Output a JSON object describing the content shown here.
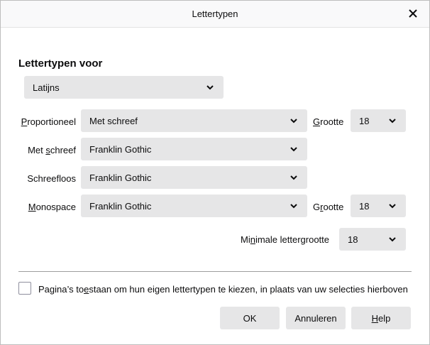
{
  "dialog": {
    "title": "Lettertypen",
    "close_icon": "close-icon"
  },
  "fonts_for": {
    "heading": "Lettertypen voor",
    "script_value": "Latijns"
  },
  "rows": {
    "proportional": {
      "label_u": "P",
      "label_rest": "roportioneel",
      "value": "Met schreef"
    },
    "serif": {
      "label_pre": "Met ",
      "label_u": "s",
      "label_rest": "chreef",
      "value": "Franklin Gothic"
    },
    "sans": {
      "label": "Schreefloos",
      "value": "Franklin Gothic"
    },
    "mono": {
      "label_u": "M",
      "label_rest": "onospace",
      "value": "Franklin Gothic"
    }
  },
  "size1": {
    "label_u": "G",
    "label_rest": "rootte",
    "value": "18"
  },
  "size2": {
    "label_pre": "G",
    "label_u": "r",
    "label_rest": "ootte",
    "value": "18"
  },
  "min_size": {
    "label_pre": "Mi",
    "label_u": "n",
    "label_rest": "imale lettergrootte",
    "value": "18"
  },
  "allow_pages": {
    "label_pre": "Pagina’s to",
    "label_u": "e",
    "label_rest": "staan om hun eigen lettertypen te kiezen, in plaats van uw selecties hierboven",
    "checked": false
  },
  "buttons": {
    "ok": "OK",
    "cancel": "Annuleren",
    "help_u": "H",
    "help_rest": "elp"
  }
}
